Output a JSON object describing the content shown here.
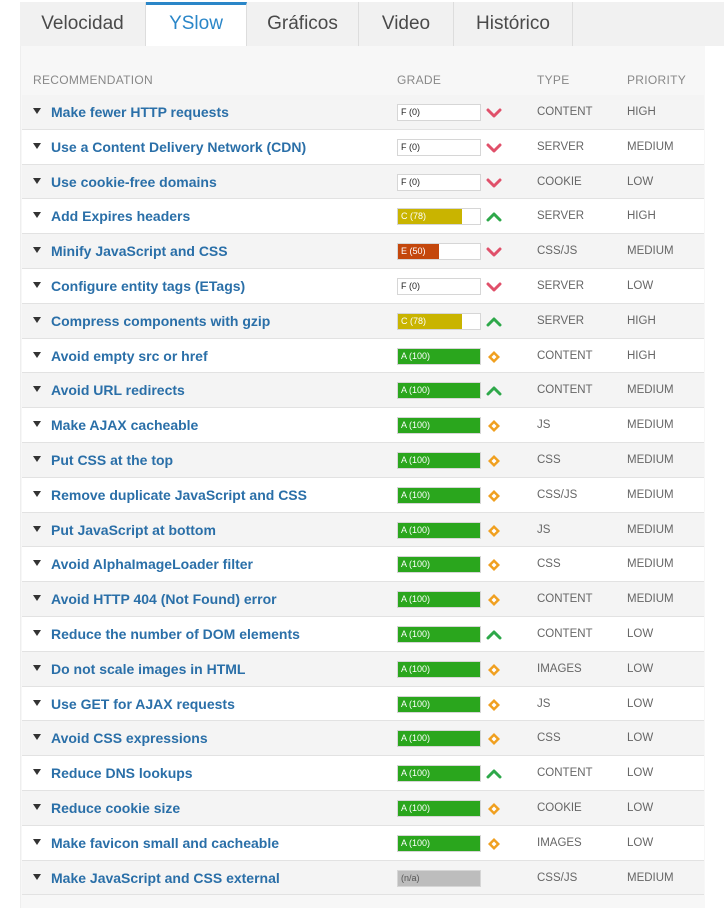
{
  "tabs": [
    {
      "label": "Velocidad",
      "active": false
    },
    {
      "label": "YSlow",
      "active": true
    },
    {
      "label": "Gráficos",
      "active": false
    },
    {
      "label": "Video",
      "active": false
    },
    {
      "label": "Histórico",
      "active": false
    }
  ],
  "table": {
    "headers": {
      "recommendation": "RECOMMENDATION",
      "grade": "GRADE",
      "type": "TYPE",
      "priority": "PRIORITY"
    },
    "rows": [
      {
        "recommendation": "Make fewer HTTP requests",
        "grade": "F (0)",
        "score": 0,
        "grade_color": "none",
        "trend": "down",
        "type": "CONTENT",
        "priority": "HIGH"
      },
      {
        "recommendation": "Use a Content Delivery Network (CDN)",
        "grade": "F (0)",
        "score": 0,
        "grade_color": "none",
        "trend": "down",
        "type": "SERVER",
        "priority": "MEDIUM"
      },
      {
        "recommendation": "Use cookie-free domains",
        "grade": "F (0)",
        "score": 0,
        "grade_color": "none",
        "trend": "down",
        "type": "COOKIE",
        "priority": "LOW"
      },
      {
        "recommendation": "Add Expires headers",
        "grade": "C (78)",
        "score": 78,
        "grade_color": "#c9b400",
        "trend": "up",
        "type": "SERVER",
        "priority": "HIGH"
      },
      {
        "recommendation": "Minify JavaScript and CSS",
        "grade": "E (50)",
        "score": 50,
        "grade_color": "#c4470c",
        "trend": "down",
        "type": "CSS/JS",
        "priority": "MEDIUM"
      },
      {
        "recommendation": "Configure entity tags (ETags)",
        "grade": "F (0)",
        "score": 0,
        "grade_color": "none",
        "trend": "down",
        "type": "SERVER",
        "priority": "LOW"
      },
      {
        "recommendation": "Compress components with gzip",
        "grade": "C (78)",
        "score": 78,
        "grade_color": "#c9b400",
        "trend": "up",
        "type": "SERVER",
        "priority": "HIGH"
      },
      {
        "recommendation": "Avoid empty src or href",
        "grade": "A (100)",
        "score": 100,
        "grade_color": "#2aa61d",
        "trend": "same",
        "type": "CONTENT",
        "priority": "HIGH"
      },
      {
        "recommendation": "Avoid URL redirects",
        "grade": "A (100)",
        "score": 100,
        "grade_color": "#2aa61d",
        "trend": "up",
        "type": "CONTENT",
        "priority": "MEDIUM"
      },
      {
        "recommendation": "Make AJAX cacheable",
        "grade": "A (100)",
        "score": 100,
        "grade_color": "#2aa61d",
        "trend": "same",
        "type": "JS",
        "priority": "MEDIUM"
      },
      {
        "recommendation": "Put CSS at the top",
        "grade": "A (100)",
        "score": 100,
        "grade_color": "#2aa61d",
        "trend": "same",
        "type": "CSS",
        "priority": "MEDIUM"
      },
      {
        "recommendation": "Remove duplicate JavaScript and CSS",
        "grade": "A (100)",
        "score": 100,
        "grade_color": "#2aa61d",
        "trend": "same",
        "type": "CSS/JS",
        "priority": "MEDIUM"
      },
      {
        "recommendation": "Put JavaScript at bottom",
        "grade": "A (100)",
        "score": 100,
        "grade_color": "#2aa61d",
        "trend": "same",
        "type": "JS",
        "priority": "MEDIUM"
      },
      {
        "recommendation": "Avoid AlphaImageLoader filter",
        "grade": "A (100)",
        "score": 100,
        "grade_color": "#2aa61d",
        "trend": "same",
        "type": "CSS",
        "priority": "MEDIUM"
      },
      {
        "recommendation": "Avoid HTTP 404 (Not Found) error",
        "grade": "A (100)",
        "score": 100,
        "grade_color": "#2aa61d",
        "trend": "same",
        "type": "CONTENT",
        "priority": "MEDIUM"
      },
      {
        "recommendation": "Reduce the number of DOM elements",
        "grade": "A (100)",
        "score": 100,
        "grade_color": "#2aa61d",
        "trend": "up",
        "type": "CONTENT",
        "priority": "LOW"
      },
      {
        "recommendation": "Do not scale images in HTML",
        "grade": "A (100)",
        "score": 100,
        "grade_color": "#2aa61d",
        "trend": "same",
        "type": "IMAGES",
        "priority": "LOW"
      },
      {
        "recommendation": "Use GET for AJAX requests",
        "grade": "A (100)",
        "score": 100,
        "grade_color": "#2aa61d",
        "trend": "same",
        "type": "JS",
        "priority": "LOW"
      },
      {
        "recommendation": "Avoid CSS expressions",
        "grade": "A (100)",
        "score": 100,
        "grade_color": "#2aa61d",
        "trend": "same",
        "type": "CSS",
        "priority": "LOW"
      },
      {
        "recommendation": "Reduce DNS lookups",
        "grade": "A (100)",
        "score": 100,
        "grade_color": "#2aa61d",
        "trend": "up",
        "type": "CONTENT",
        "priority": "LOW"
      },
      {
        "recommendation": "Reduce cookie size",
        "grade": "A (100)",
        "score": 100,
        "grade_color": "#2aa61d",
        "trend": "same",
        "type": "COOKIE",
        "priority": "LOW"
      },
      {
        "recommendation": "Make favicon small and cacheable",
        "grade": "A (100)",
        "score": 100,
        "grade_color": "#2aa61d",
        "trend": "same",
        "type": "IMAGES",
        "priority": "LOW"
      },
      {
        "recommendation": "Make JavaScript and CSS external",
        "grade": "(n/a)",
        "score": null,
        "grade_color": "#bdbdbd",
        "trend": "none",
        "type": "CSS/JS",
        "priority": "MEDIUM"
      }
    ]
  },
  "colors": {
    "accent": "#2a86c8",
    "link": "#2a6fa8",
    "trend_down": "#e0506a",
    "trend_up": "#2ea84a",
    "trend_same": "#f0a020"
  }
}
